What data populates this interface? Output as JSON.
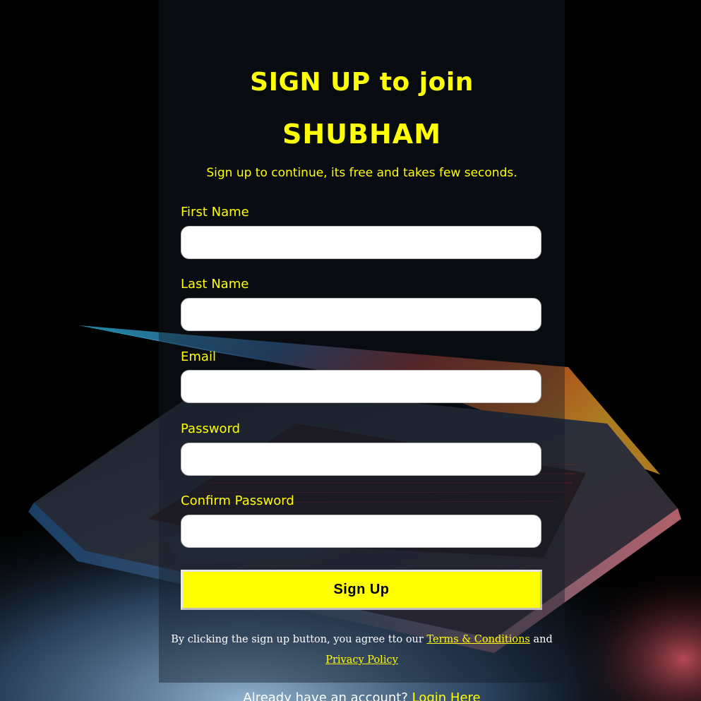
{
  "colors": {
    "accent": "#ffff00",
    "top_bar": "#17b890",
    "background": "#010101"
  },
  "header": {
    "title_line1": "SIGN UP to join",
    "title_line2": "SHUBHAM",
    "subtitle": "Sign up to continue, its free and takes few seconds."
  },
  "form": {
    "first_name_label": "First Name",
    "first_name_value": "",
    "last_name_label": "Last Name",
    "last_name_value": "",
    "email_label": "Email",
    "email_value": "",
    "password_label": "Password",
    "password_value": "",
    "confirm_password_label": "Confirm Password",
    "confirm_password_value": "",
    "submit_label": "Sign Up"
  },
  "terms": {
    "prefix": "By clicking the sign up button, you agree tto our ",
    "terms_link": "Terms & Conditions",
    "middle": " and",
    "privacy_link": "Privacy Policy"
  },
  "login": {
    "prefix": "Already have an account? ",
    "link": "Login Here"
  },
  "background_image": "laptop-photo"
}
